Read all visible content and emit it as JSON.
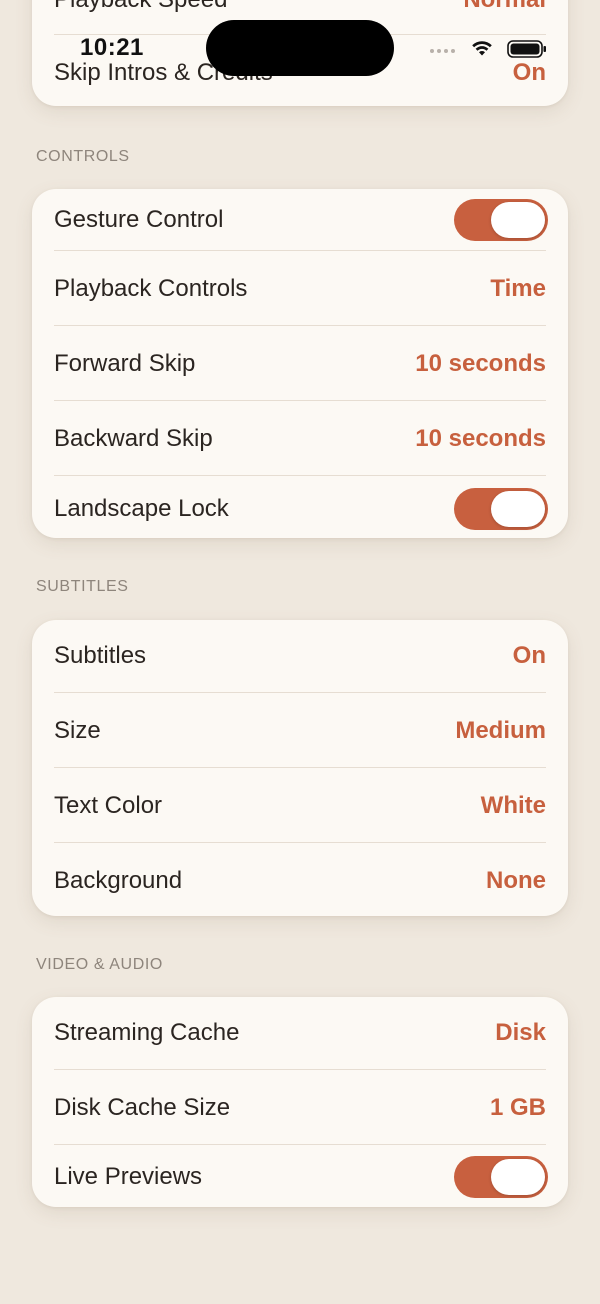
{
  "status": {
    "time": "10:21"
  },
  "top_card": {
    "rows": [
      {
        "label": "Playback Speed",
        "value": "Normal"
      },
      {
        "label": "Skip Intros & Credits",
        "value": "On"
      }
    ]
  },
  "controls": {
    "header": "CONTROLS",
    "rows": [
      {
        "label": "Gesture Control",
        "toggle": true
      },
      {
        "label": "Playback Controls",
        "value": "Time"
      },
      {
        "label": "Forward Skip",
        "value": "10 seconds"
      },
      {
        "label": "Backward Skip",
        "value": "10 seconds"
      },
      {
        "label": "Landscape Lock",
        "toggle": true
      }
    ]
  },
  "subtitles": {
    "header": "SUBTITLES",
    "rows": [
      {
        "label": "Subtitles",
        "value": "On"
      },
      {
        "label": "Size",
        "value": "Medium"
      },
      {
        "label": "Text Color",
        "value": "White"
      },
      {
        "label": "Background",
        "value": "None"
      }
    ]
  },
  "video_audio": {
    "header": "VIDEO & AUDIO",
    "rows": [
      {
        "label": "Streaming Cache",
        "value": "Disk"
      },
      {
        "label": "Disk Cache Size",
        "value": "1 GB"
      },
      {
        "label": "Live Previews",
        "toggle": true
      }
    ]
  },
  "colors": {
    "accent": "#c8603f",
    "background": "#efe8de",
    "card": "#fcf9f4",
    "section_header": "#8e857c"
  },
  "icons": [
    "signal-dots-icon",
    "wifi-icon",
    "battery-icon"
  ]
}
